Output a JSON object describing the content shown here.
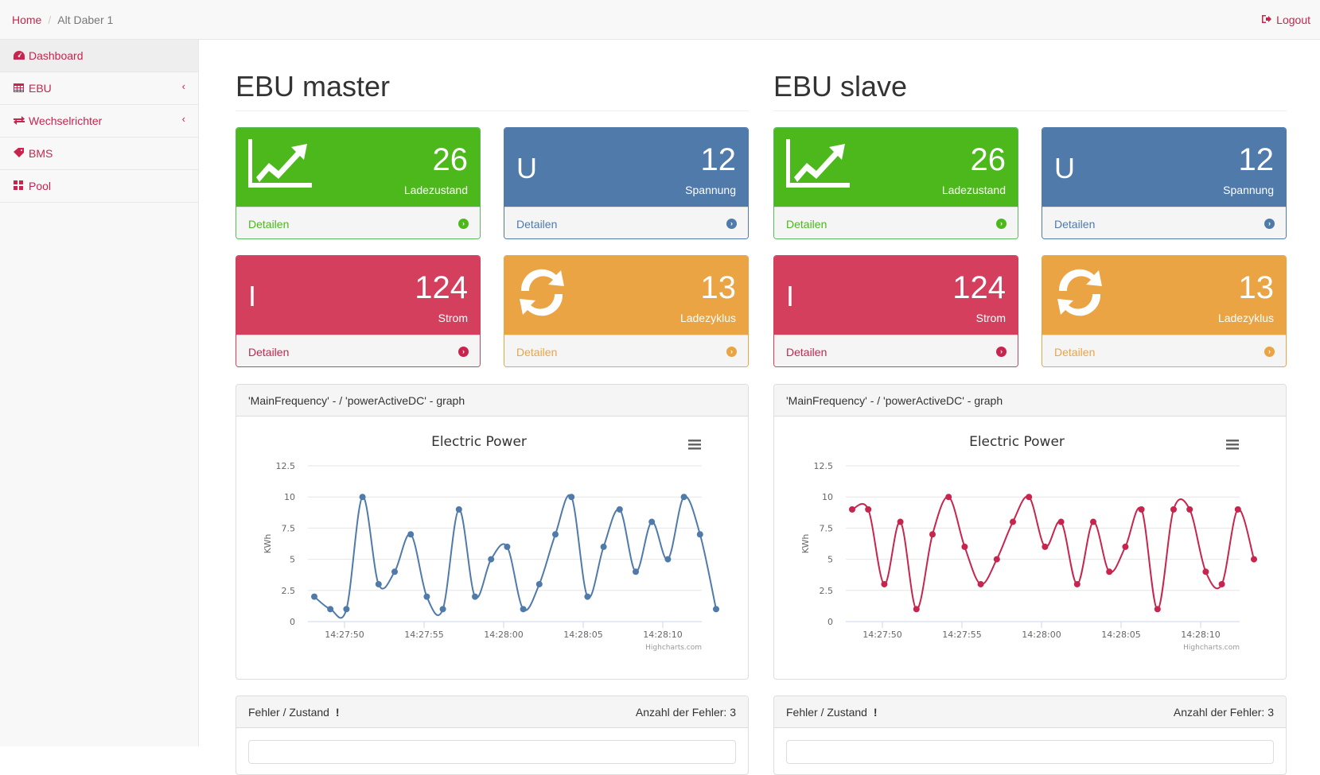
{
  "breadcrumb": {
    "home": "Home",
    "current": "Alt Daber 1"
  },
  "header": {
    "logout": "Logout"
  },
  "sidebar": {
    "items": [
      {
        "label": "Dashboard",
        "icon": "dashboard-icon"
      },
      {
        "label": "EBU",
        "icon": "table-icon"
      },
      {
        "label": "Wechselrichter",
        "icon": "exchange-icon"
      },
      {
        "label": "BMS",
        "icon": "tag-icon"
      },
      {
        "label": "Pool",
        "icon": "grid-icon"
      }
    ]
  },
  "colors": {
    "accent": "#c7254e",
    "green": "#4cb81b",
    "blue": "#4f7aaa",
    "red": "#d43f5e",
    "orange": "#eaa443",
    "series_master": "#4f7aaa",
    "series_slave": "#c7254e"
  },
  "master": {
    "title": "EBU master",
    "cards": [
      {
        "value": "26",
        "label": "Ladezustand",
        "link": "Detailen",
        "icon": "line-chart-icon"
      },
      {
        "value": "12",
        "label": "Spannung",
        "link": "Detailen",
        "letter": "U"
      },
      {
        "value": "124",
        "label": "Strom",
        "link": "Detailen",
        "letter": "I"
      },
      {
        "value": "13",
        "label": "Ladezyklus",
        "link": "Detailen",
        "icon": "refresh-icon"
      }
    ],
    "graph_title": "'MainFrequency' - / 'powerActiveDC' - graph",
    "errors_title": "Fehler / Zustand",
    "errors_count": "Anzahl der Fehler: 3"
  },
  "slave": {
    "title": "EBU slave",
    "cards": [
      {
        "value": "26",
        "label": "Ladezustand",
        "link": "Detailen",
        "icon": "line-chart-icon"
      },
      {
        "value": "12",
        "label": "Spannung",
        "link": "Detailen",
        "letter": "U"
      },
      {
        "value": "124",
        "label": "Strom",
        "link": "Detailen",
        "letter": "I"
      },
      {
        "value": "13",
        "label": "Ladezyklus",
        "link": "Detailen",
        "icon": "refresh-icon"
      }
    ],
    "graph_title": "'MainFrequency' - / 'powerActiveDC' - graph",
    "errors_title": "Fehler / Zustand",
    "errors_count": "Anzahl der Fehler: 3"
  },
  "chart_data": [
    {
      "type": "line",
      "title": "Electric Power",
      "ylabel": "KWh",
      "xlabel": "",
      "ylim": [
        0,
        12.5
      ],
      "yticks": [
        "0",
        "2.5",
        "5",
        "7.5",
        "10",
        "12.5"
      ],
      "xticks": [
        "14:27:50",
        "14:27:55",
        "14:28:00",
        "14:28:05",
        "14:28:10"
      ],
      "credit": "Highcharts.com",
      "x_seconds": [
        48,
        49,
        50,
        51,
        52,
        53,
        54,
        55,
        56,
        57,
        58,
        59,
        60,
        61,
        62,
        63,
        64,
        65,
        66,
        67,
        68,
        69,
        70,
        71,
        72,
        73,
        74,
        75
      ],
      "values": [
        2,
        1,
        1,
        10,
        3,
        4,
        7,
        2,
        1,
        9,
        2,
        5,
        6,
        1,
        3,
        7,
        10,
        2,
        6,
        9,
        4,
        8,
        5,
        10,
        7,
        1
      ],
      "series": [
        {
          "values": [
            2,
            1,
            1,
            10,
            3,
            4,
            7,
            2,
            1,
            9,
            2,
            5,
            6,
            1,
            3,
            7,
            10,
            2,
            6,
            9,
            4,
            8,
            5,
            10,
            7,
            1
          ]
        }
      ]
    },
    {
      "type": "line",
      "title": "Electric Power",
      "ylabel": "KWh",
      "xlabel": "",
      "ylim": [
        0,
        12.5
      ],
      "yticks": [
        "0",
        "2.5",
        "5",
        "7.5",
        "10",
        "12.5"
      ],
      "xticks": [
        "14:27:50",
        "14:27:55",
        "14:28:00",
        "14:28:05",
        "14:28:10"
      ],
      "credit": "Highcharts.com",
      "values": [
        9,
        9,
        3,
        8,
        1,
        7,
        10,
        6,
        3,
        5,
        8,
        10,
        6,
        8,
        3,
        8,
        4,
        6,
        9,
        1,
        9,
        9,
        4,
        3,
        9,
        5
      ],
      "series": [
        {
          "values": [
            9,
            9,
            3,
            8,
            1,
            7,
            10,
            6,
            3,
            5,
            8,
            10,
            6,
            8,
            3,
            8,
            4,
            6,
            9,
            1,
            9,
            9,
            4,
            3,
            9,
            5
          ]
        }
      ]
    }
  ]
}
